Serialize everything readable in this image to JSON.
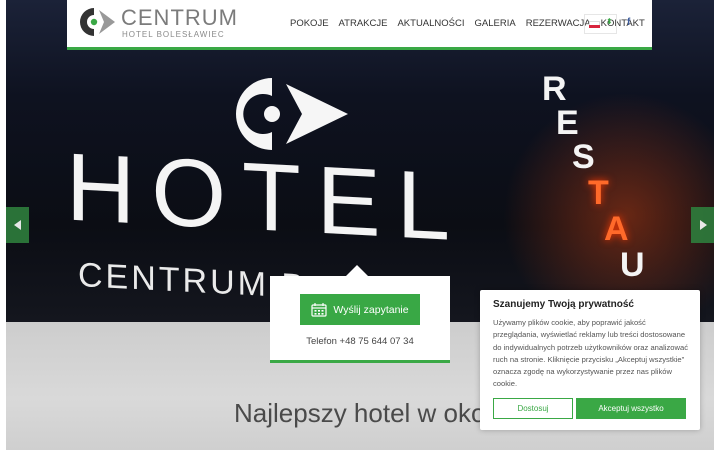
{
  "header": {
    "brand_title": "CENTRUM",
    "brand_subtitle": "HOTEL BOLESŁAWIEC",
    "nav": [
      "POKOJE",
      "ATRAKCJE",
      "AKTUALNOŚCI",
      "GALERIA",
      "REZERWACJA",
      "KONTAKT"
    ],
    "facebook_icon": "f",
    "lang_caret": "⬍"
  },
  "hero": {
    "sign_hotel": "HOTEL",
    "sign_centrum": "CENTRUM B",
    "heading": "Najlepszy hotel w okolic",
    "arrow_left": "◀",
    "arrow_right": "▶"
  },
  "booking": {
    "button_label": "Wyślij zapytanie",
    "phone": "Telefon +48 75 644 07 34"
  },
  "cookie": {
    "title": "Szanujemy Twoją prywatność",
    "text": "Używamy plików cookie, aby poprawić jakość przeglądania, wyświetlać reklamy lub treści dostosowane do indywidualnych potrzeb użytkowników oraz analizować ruch na stronie. Kliknięcie przycisku „Akceptuj wszystkie\" oznacza zgodę na wykorzystywanie przez nas plików cookie.",
    "customize": "Dostosuj",
    "accept_all": "Akceptuj wszystko"
  },
  "colors": {
    "accent": "#3aa845",
    "arrow_bg": "#2e7d3c",
    "facebook": "#3b5a9a"
  }
}
